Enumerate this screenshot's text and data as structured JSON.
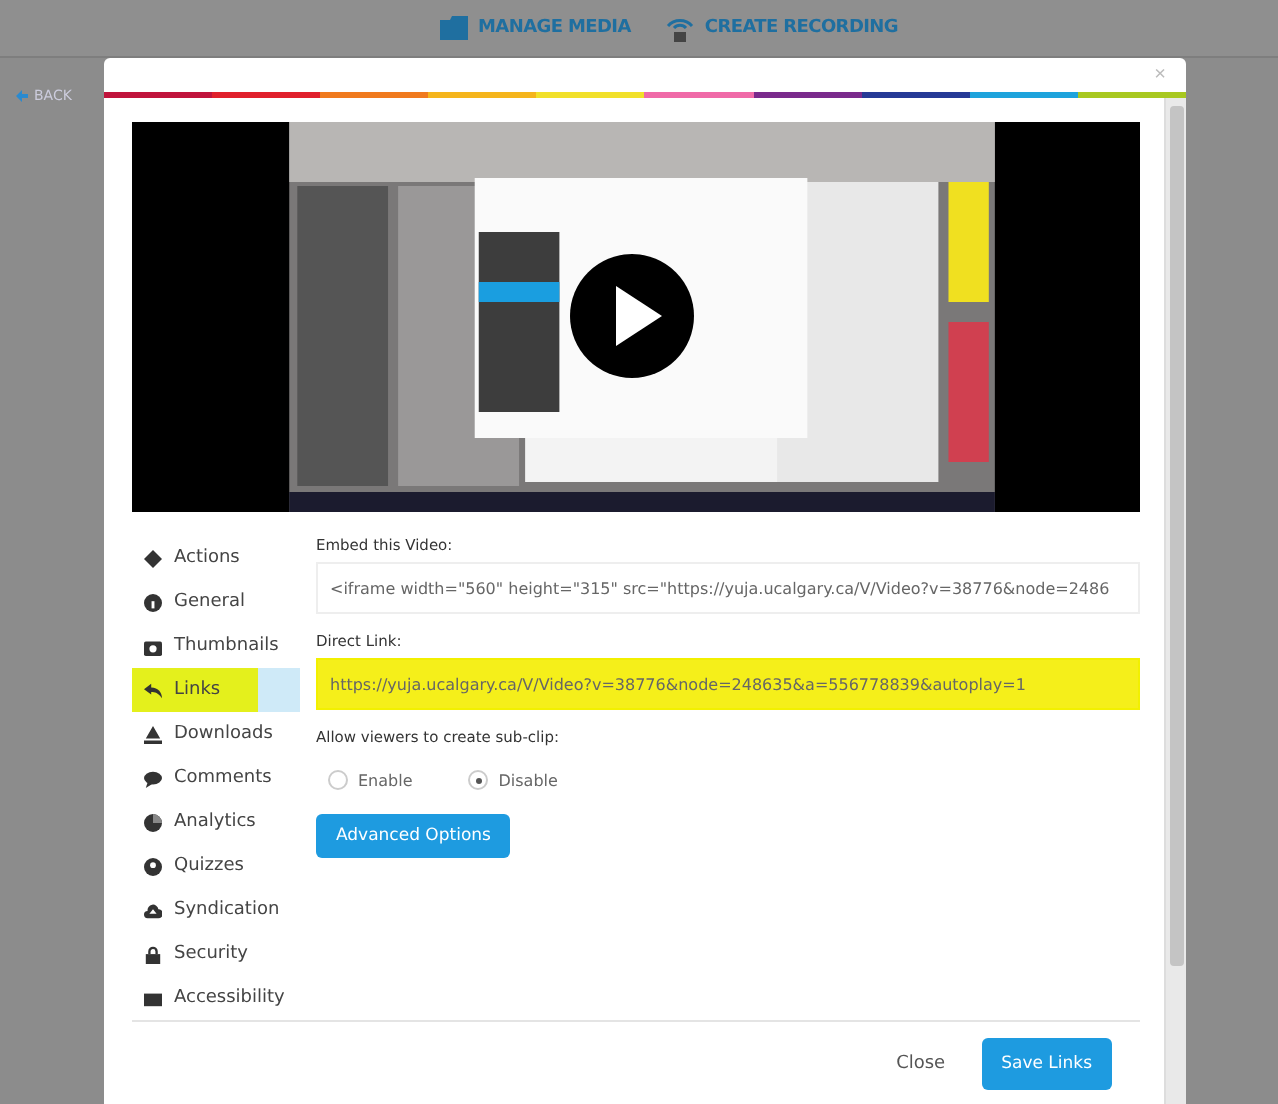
{
  "top_nav": [
    {
      "label": "MANAGE MEDIA",
      "kind": "media"
    },
    {
      "label": "CREATE RECORDING",
      "kind": "recording"
    }
  ],
  "back": {
    "label": "BACK"
  },
  "modal": {
    "close": "×",
    "sidebar": [
      {
        "label": "Actions",
        "selected": false,
        "highlighted": false
      },
      {
        "label": "General",
        "selected": false,
        "highlighted": false
      },
      {
        "label": "Thumbnails",
        "selected": false,
        "highlighted": false
      },
      {
        "label": "Links",
        "selected": true,
        "highlighted": true
      },
      {
        "label": "Downloads",
        "selected": false,
        "highlighted": false
      },
      {
        "label": "Comments",
        "selected": false,
        "highlighted": false
      },
      {
        "label": "Analytics",
        "selected": false,
        "highlighted": false
      },
      {
        "label": "Quizzes",
        "selected": false,
        "highlighted": false
      },
      {
        "label": "Syndication",
        "selected": false,
        "highlighted": false
      },
      {
        "label": "Security",
        "selected": false,
        "highlighted": false
      },
      {
        "label": "Accessibility",
        "selected": false,
        "highlighted": false
      }
    ],
    "embed": {
      "label": "Embed this Video:",
      "value": "<iframe width=\"560\" height=\"315\" src=\"https://yuja.ucalgary.ca/V/Video?v=38776&node=2486",
      "highlighted": false
    },
    "direct": {
      "label": "Direct Link:",
      "value": "https://yuja.ucalgary.ca/V/Video?v=38776&node=248635&a=556778839&autoplay=1",
      "highlighted": true
    },
    "subclip": {
      "label": "Allow viewers to create sub-clip:",
      "options": [
        {
          "label": "Enable",
          "selected": false
        },
        {
          "label": "Disable",
          "selected": true
        }
      ]
    },
    "advanced_button": "Advanced Options",
    "footer": {
      "close": "Close",
      "save": "Save Links"
    }
  }
}
